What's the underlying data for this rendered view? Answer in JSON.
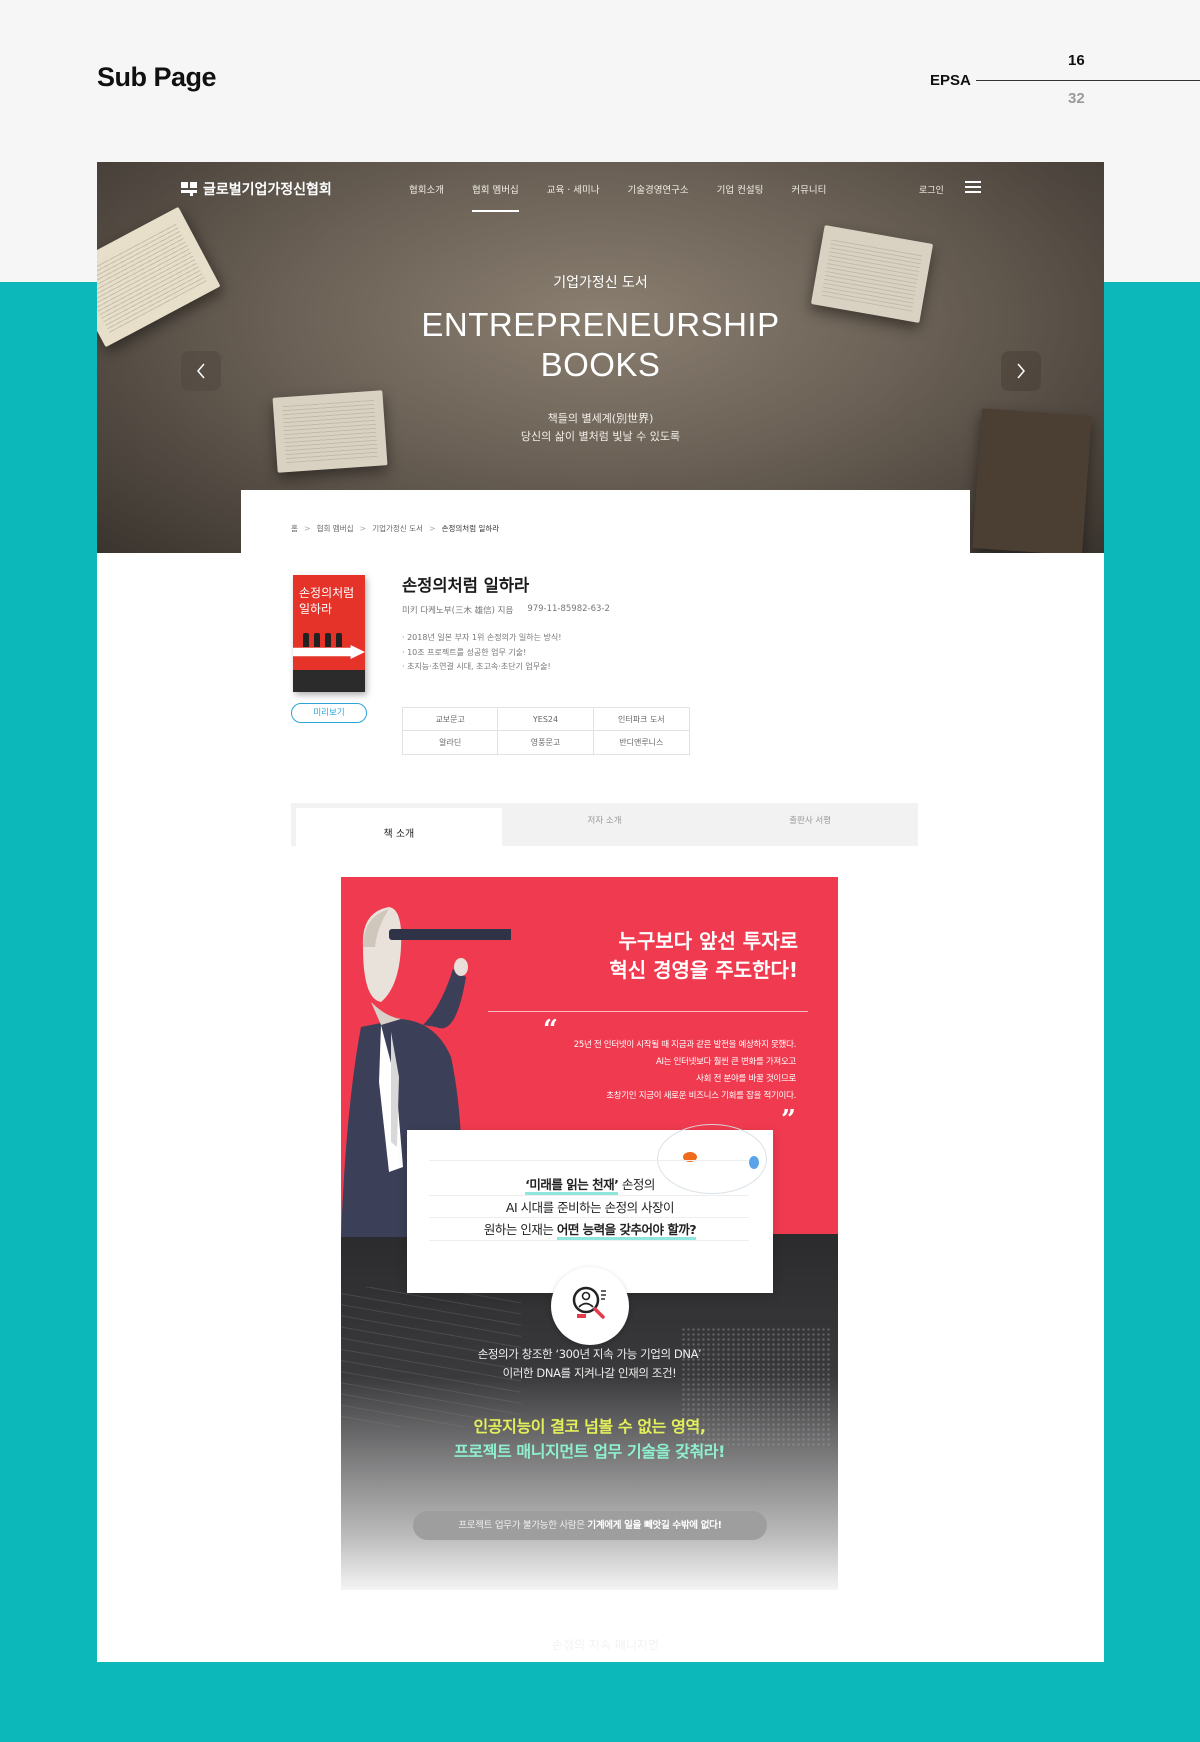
{
  "presentation": {
    "title": "Sub Page",
    "brand": "EPSA",
    "page": "16",
    "total": "32"
  },
  "site": {
    "logo": "글로벌기업가정신협회",
    "nav": [
      "협회소개",
      "협회 멤버십",
      "교육 · 세미나",
      "기술경영연구소",
      "기업 컨설팅",
      "커뮤니티"
    ],
    "login": "로그인"
  },
  "hero": {
    "subtitle": "기업가정신 도서",
    "title_line1": "ENTREPRENEURSHIP",
    "title_line2": "BOOKS",
    "desc_line1": "책들의 별세계(別世界)",
    "desc_line2": "당신의 삶이 별처럼 빛날 수 있도록"
  },
  "breadcrumb": [
    "홈",
    "협회 멤버십",
    "기업가정신 도서",
    "손정의처럼 일하라"
  ],
  "book": {
    "cover_title": "손정의처럼 일하라",
    "title": "손정의처럼 일하라",
    "author": "미키 다케노부(三木 雄信) 지음",
    "isbn": "979-11-85982-63-2",
    "points": [
      "2018년 일본 부자 1위 손정의가 일하는 방식!",
      "10조 프로젝트를 성공한 업무 기술!",
      "초지능·초연결 시대, 초고속·초단기 업무술!"
    ],
    "preview_label": "미리보기",
    "stores": [
      "교보문고",
      "YES24",
      "인터파크 도서",
      "알라딘",
      "영풍문고",
      "반디앤루니스"
    ]
  },
  "tabs": [
    "책 소개",
    "저자 소개",
    "출판사 서평"
  ],
  "promo": {
    "headline_line1": "누구보다 앞선 투자로",
    "headline_line2": "혁신 경영을 주도한다!",
    "quote_open": "“",
    "quote_close": "”",
    "quote": [
      "25년 전 인터넷이 시작될 때 지금과 같은 발전을 예상하지 못했다.",
      "AI는 인터넷보다 훨씬 큰 변화를 가져오고",
      "사회 전 분야를 바꿀 것이므로",
      "초창기인 지금이 새로운 비즈니스 기회를 잡을 적기이다."
    ],
    "card_line1_b": "‘미래를 읽는 천재’",
    "card_line1": " 손정의",
    "card_line2": "AI 시대를 준비하는 손정의 사장이",
    "card_line3": "원하는 인재는 ",
    "card_line3_b": "어떤 능력을 갖추어야 할까?",
    "dna_line1": "손정의가 창조한 ‘300년 지속 가능 기업의 DNA’",
    "dna_line2": "이러한 DNA를 지켜나갈 인재의 조건!",
    "highlight_line1": "인공지능이 결코 넘볼 수 없는 영역,",
    "highlight_line2": "프로젝트 매니지먼트 업무 기술을 갖춰라!",
    "pill_text": "프로젝트 업무가 불가능한 사람은 ",
    "pill_bold": "기계에게 일을 빼앗길 수밖에 없다!",
    "next_title": "손정의 지속 매니지먼"
  },
  "colors": {
    "teal": "#0db8ba",
    "promo_red": "#f03a4f",
    "preview_blue": "#2aa6d8"
  }
}
